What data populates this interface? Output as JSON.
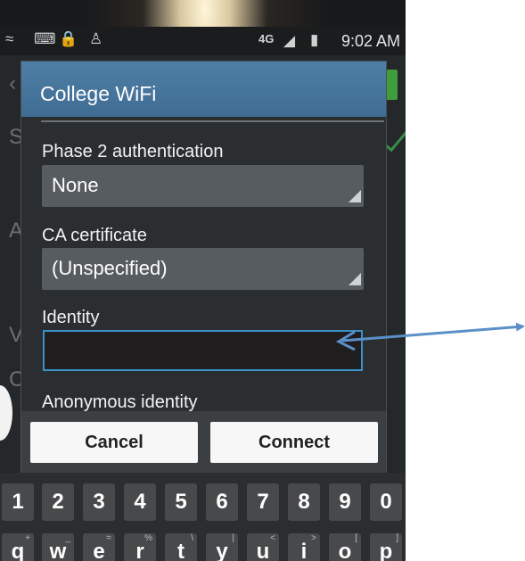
{
  "status_bar": {
    "time": "9:02 AM",
    "network": "4G",
    "icons": [
      "wifi-icon",
      "keyboard-icon",
      "lock-warning-icon",
      "usb-icon",
      "signal-icon",
      "battery-icon"
    ]
  },
  "dialog": {
    "title": "College WiFi",
    "fields": {
      "phase2": {
        "label": "Phase 2 authentication",
        "value": "None"
      },
      "ca_cert": {
        "label": "CA certificate",
        "value": "(Unspecified)"
      },
      "identity": {
        "label": "Identity",
        "value": ""
      },
      "anonymous": {
        "label": "Anonymous identity"
      }
    },
    "buttons": {
      "cancel": "Cancel",
      "connect": "Connect"
    }
  },
  "keyboard": {
    "number_row": [
      "1",
      "2",
      "3",
      "4",
      "5",
      "6",
      "7",
      "8",
      "9",
      "0"
    ],
    "letter_row": [
      "q",
      "w",
      "e",
      "r",
      "t",
      "y",
      "u",
      "i",
      "o",
      "p"
    ],
    "letter_row_secondary": [
      "+",
      "_",
      "=",
      "%",
      "\\",
      "|",
      "<",
      ">",
      "[",
      "]"
    ]
  },
  "colors": {
    "dialog_header": "#4a79a0",
    "input_focus": "#3a91c8",
    "annotation_arrow": "#5b8fc7"
  }
}
